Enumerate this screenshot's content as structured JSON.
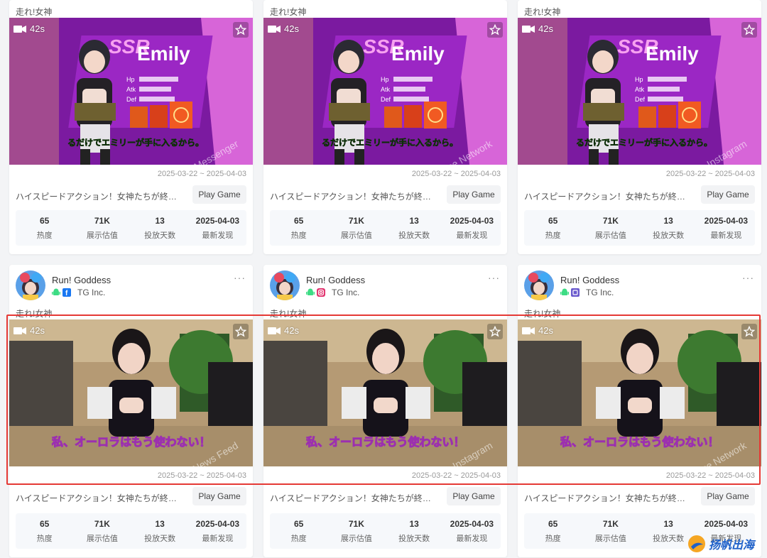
{
  "cards": [
    {
      "row": "top",
      "game_title": "走れ!女神",
      "duration": "42s",
      "watermark": "Messenger",
      "dates": "2025-03-22 ~ 2025-04-03",
      "desc": "ハイスピードアクション！女神たちが終末の戦...",
      "play_label": "Play Game",
      "stats": [
        {
          "v": "65",
          "l": "热度"
        },
        {
          "v": "71K",
          "l": "展示估值"
        },
        {
          "v": "13",
          "l": "投放天数"
        },
        {
          "v": "2025-04-03",
          "l": "最新发现"
        }
      ]
    },
    {
      "row": "top",
      "game_title": "走れ!女神",
      "duration": "42s",
      "watermark": "Audience Network",
      "dates": "2025-03-22 ~ 2025-04-03",
      "desc": "ハイスピードアクション！女神たちが終末の戦...",
      "play_label": "Play Game",
      "stats": [
        {
          "v": "65",
          "l": "热度"
        },
        {
          "v": "71K",
          "l": "展示估值"
        },
        {
          "v": "13",
          "l": "投放天数"
        },
        {
          "v": "2025-04-03",
          "l": "最新发现"
        }
      ]
    },
    {
      "row": "top",
      "game_title": "走れ!女神",
      "duration": "42s",
      "watermark": "Instagram",
      "dates": "2025-03-22 ~ 2025-04-03",
      "desc": "ハイスピードアクション！女神たちが終末の戦...",
      "play_label": "Play Game",
      "stats": [
        {
          "v": "65",
          "l": "热度"
        },
        {
          "v": "71K",
          "l": "展示估值"
        },
        {
          "v": "13",
          "l": "投放天数"
        },
        {
          "v": "2025-04-03",
          "l": "最新发现"
        }
      ]
    },
    {
      "row": "bottom",
      "app_name": "Run! Goddess",
      "publisher": "TG Inc.",
      "platform_icons": [
        "android-icon",
        "facebook-icon"
      ],
      "game_title": "走れ!女神",
      "duration": "42s",
      "watermark": "News Feed",
      "dates": "2025-03-22 ~ 2025-04-03",
      "desc": "ハイスピードアクション！女神たちが終末の戦...",
      "play_label": "Play Game",
      "stats": [
        {
          "v": "65",
          "l": "热度"
        },
        {
          "v": "71K",
          "l": "展示估值"
        },
        {
          "v": "13",
          "l": "投放天数"
        },
        {
          "v": "2025-04-03",
          "l": "最新发现"
        }
      ]
    },
    {
      "row": "bottom",
      "app_name": "Run! Goddess",
      "publisher": "TG Inc.",
      "platform_icons": [
        "android-icon",
        "instagram-icon"
      ],
      "game_title": "走れ!女神",
      "duration": "42s",
      "watermark": "Instagram",
      "dates": "2025-03-22 ~ 2025-04-03",
      "desc": "ハイスピードアクション！女神たちが終末の戦...",
      "play_label": "Play Game",
      "stats": [
        {
          "v": "65",
          "l": "热度"
        },
        {
          "v": "71K",
          "l": "展示估值"
        },
        {
          "v": "13",
          "l": "投放天数"
        },
        {
          "v": "2025-04-03",
          "l": "最新发现"
        }
      ]
    },
    {
      "row": "bottom",
      "app_name": "Run! Goddess",
      "publisher": "TG Inc.",
      "platform_icons": [
        "android-icon",
        "audience-network-icon"
      ],
      "game_title": "走れ!女神",
      "duration": "42s",
      "watermark": "Audience Network",
      "dates": "2025-03-22 ~ 2025-04-03",
      "desc": "ハイスピードアクション！女神たちが終末の戦...",
      "play_label": "Play Game",
      "stats": [
        {
          "v": "65",
          "l": "热度"
        },
        {
          "v": "71K",
          "l": "展示估值"
        },
        {
          "v": "13",
          "l": "投放天数"
        },
        {
          "v": "2025-04-03",
          "l": "最新发现"
        }
      ]
    }
  ],
  "creative_top": {
    "rarity": "SSR",
    "name": "Emily",
    "stat_labels": [
      "Hp",
      "Atk",
      "Def"
    ],
    "caption": "るだけでエミリーが手に入るから。"
  },
  "creative_bottom": {
    "caption": "私、オーロラはもう使わない！"
  },
  "brand_logo_text": "扬帆出海",
  "colors": {
    "highlight": "#e53935",
    "brand": "#1e60c9",
    "purple": "#b23ad1"
  }
}
